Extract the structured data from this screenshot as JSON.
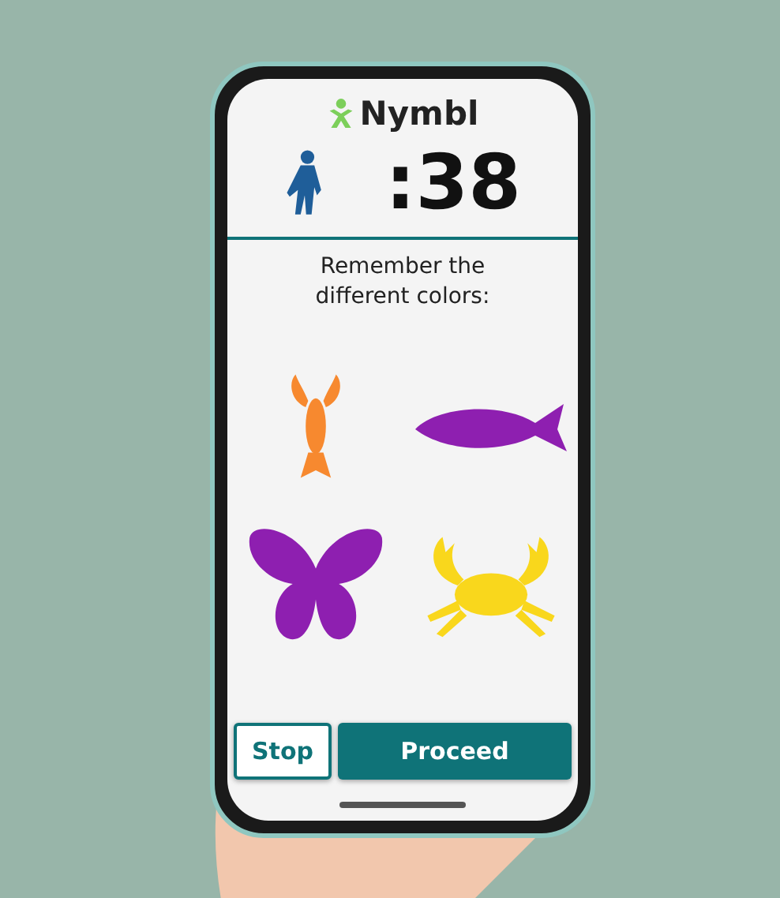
{
  "app": {
    "logo": "Nymbl"
  },
  "timer": ":38",
  "instruction": "Remember the different colors:",
  "items": [
    {
      "kind": "lobster",
      "color": "#f7892f"
    },
    {
      "kind": "fish",
      "color": "#8e1fb0"
    },
    {
      "kind": "butterfly",
      "color": "#8e1fb0"
    },
    {
      "kind": "crab",
      "color": "#f9d71c"
    }
  ],
  "buttons": [
    {
      "label": "Stop",
      "kind": "secondary"
    },
    {
      "label": "Proceed",
      "kind": "primary"
    }
  ]
}
